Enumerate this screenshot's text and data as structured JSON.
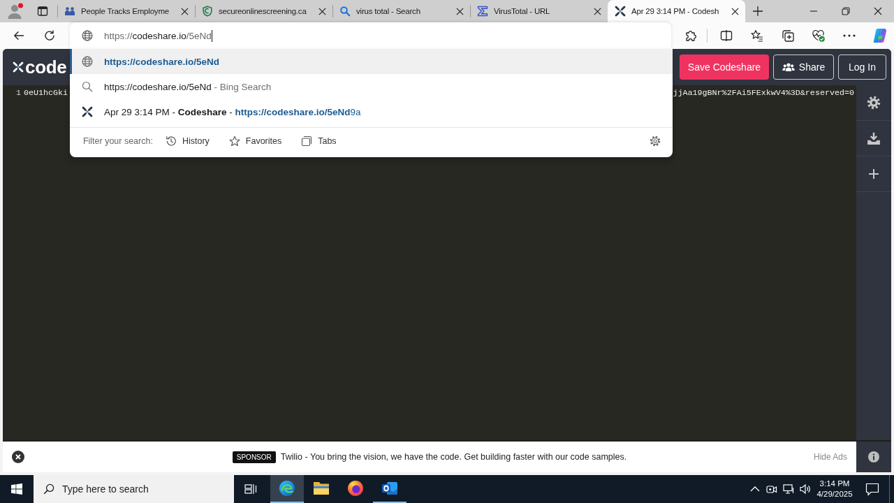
{
  "tab_strip": {
    "tabs": [
      {
        "kind": "people",
        "title": "People Tracks Employme",
        "selected": false
      },
      {
        "kind": "shield",
        "title": "secureonlinescreening.ca",
        "selected": false
      },
      {
        "kind": "search",
        "title": "virus total - Search",
        "selected": false
      },
      {
        "kind": "sigma",
        "title": "VirusTotal - URL",
        "selected": false
      },
      {
        "kind": "codeshare",
        "title": "Apr 29 3:14 PM - Codesh",
        "selected": true
      }
    ]
  },
  "address_bar": {
    "value_segments": [
      {
        "text": "https://",
        "dimmed": true
      },
      {
        "text": "codeshare.io",
        "dimmed": false
      },
      {
        "text": "/5eNd",
        "dimmed": true
      }
    ],
    "suggestions": [
      {
        "kind": "url",
        "text": "https://codeshare.io/5eNd",
        "selected": true
      },
      {
        "kind": "search",
        "text": "https://codeshare.io/5eNd",
        "suffix": "- Bing Search",
        "selected": false
      },
      {
        "kind": "history",
        "text": "Apr 29 3:14 PM - **Codeshare** -",
        "url": "**https://codeshare.io/5eNd**9a",
        "selected": false
      }
    ],
    "filter": {
      "label": "Filter your search:",
      "options": [
        {
          "kind": "history",
          "label": "History"
        },
        {
          "kind": "favorites",
          "label": "Favorites"
        },
        {
          "kind": "tabs",
          "label": "Tabs"
        }
      ]
    }
  },
  "page": {
    "logo": "code",
    "buttons": [
      {
        "kind": "save",
        "label": "Save Codeshare"
      },
      {
        "kind": "share",
        "label": "Share"
      },
      {
        "kind": "login",
        "label": "Log In"
      }
    ],
    "editor_lines": [
      {
        "number": "1",
        "start": "0eU1hcGki",
        "end": "jjAa19gBNr%2FAi5FExkwV4%3D&reserved=0"
      }
    ],
    "sponsor": {
      "badge": "SPONSOR",
      "text": "Twilio - You bring the vision, we have the code. Get building faster with our code samples.",
      "hide_link": "Hide Ads"
    }
  },
  "taskbar": {
    "search": {
      "placeholder": "Type here to search"
    },
    "apps": [
      {
        "kind": "edge",
        "selected": true,
        "running": true
      },
      {
        "kind": "explorer",
        "selected": false,
        "running": false
      },
      {
        "kind": "firefox",
        "selected": false,
        "running": false
      },
      {
        "kind": "outlook",
        "selected": false,
        "running": true
      }
    ],
    "clock": {
      "time": "3:14 PM",
      "date": "4/29/2025"
    }
  }
}
